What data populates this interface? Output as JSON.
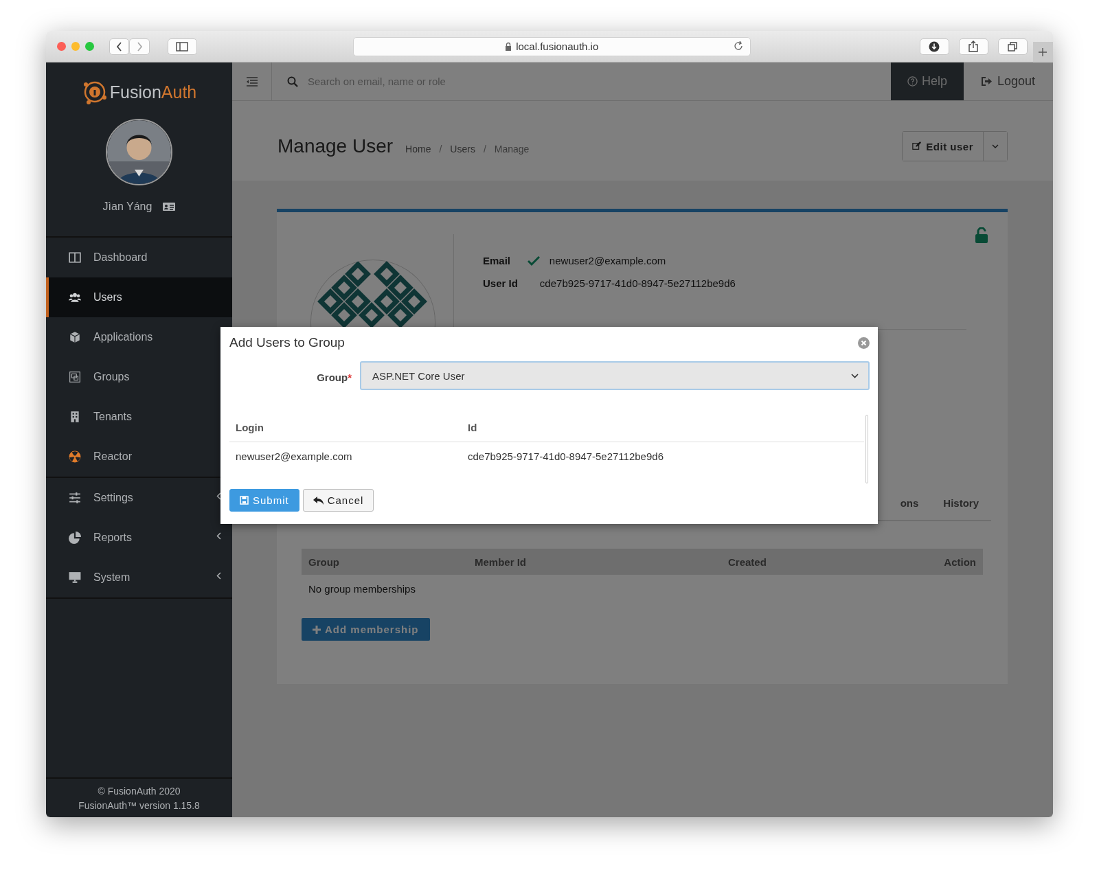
{
  "browser": {
    "url": "local.fusionauth.io"
  },
  "sidebar": {
    "brand": [
      "Fusion",
      "Auth"
    ],
    "user_name": "Jìan Yáng",
    "menu_groups": [
      {
        "items": [
          {
            "label": "Dashboard",
            "selected": false,
            "submenu": false
          },
          {
            "label": "Users",
            "selected": true,
            "submenu": false
          },
          {
            "label": "Applications",
            "selected": false,
            "submenu": false
          },
          {
            "label": "Groups",
            "selected": false,
            "submenu": false
          },
          {
            "label": "Tenants",
            "selected": false,
            "submenu": false
          },
          {
            "label": "Reactor",
            "selected": false,
            "submenu": false
          }
        ]
      },
      {
        "items": [
          {
            "label": "Settings",
            "selected": false,
            "submenu": true
          },
          {
            "label": "Reports",
            "selected": false,
            "submenu": true
          },
          {
            "label": "System",
            "selected": false,
            "submenu": true
          }
        ]
      }
    ],
    "footer": [
      "© FusionAuth 2020",
      "FusionAuth™ version 1.15.8"
    ]
  },
  "topbar": {
    "search": {
      "placeholder": "Search on email, name or role"
    },
    "help": "Help",
    "logout": "Logout"
  },
  "header": {
    "title": "Manage User",
    "breadcrumbs": [
      {
        "kind": "link",
        "label": "Home"
      },
      {
        "kind": "separator",
        "label": "/"
      },
      {
        "kind": "link",
        "label": "Users"
      },
      {
        "kind": "separator",
        "label": "/"
      },
      {
        "kind": "current",
        "label": "Manage"
      }
    ],
    "edit_button": "Edit user"
  },
  "user_card": {
    "locked": false,
    "fields": [
      {
        "label": "Email",
        "value": "newuser2@example.com",
        "verified": true
      },
      {
        "label": "User Id",
        "value": "cde7b925-9717-41d0-8947-5e27112be9d6"
      }
    ],
    "tabs": [
      {
        "label": "ons",
        "selected": false
      },
      {
        "label": "History",
        "selected": false
      }
    ],
    "memberships": {
      "columns": [
        "Group",
        "Member Id",
        "Created",
        "Action"
      ],
      "empty": "No group memberships",
      "add_button": "Add membership"
    }
  },
  "modal": {
    "title": "Add Users to Group",
    "group_label": "Group",
    "required_mark": "*",
    "group_value": "ASP.NET Core User",
    "columns": [
      "Login",
      "Id"
    ],
    "rows": [
      [
        "newuser2@example.com",
        "cde7b925-9717-41d0-8947-5e27112be9d6"
      ]
    ],
    "submit": "Submit",
    "cancel": "Cancel"
  }
}
